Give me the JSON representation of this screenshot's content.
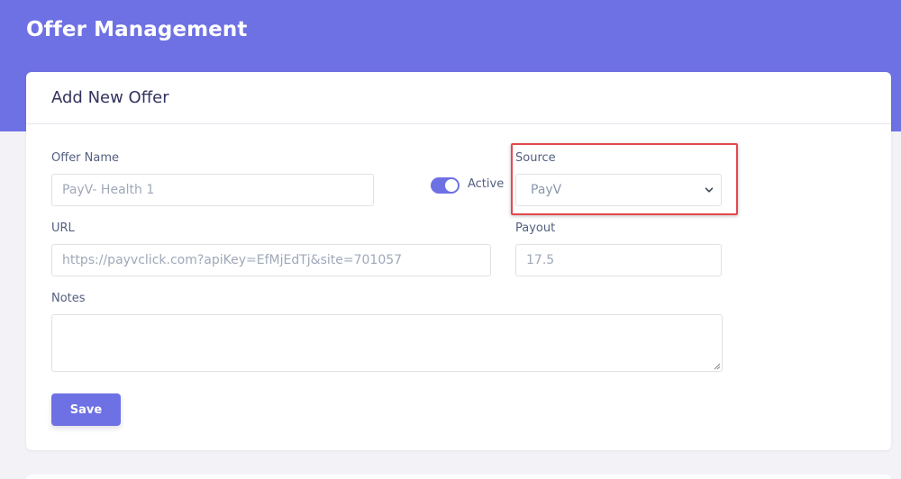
{
  "header": {
    "title": "Offer Management",
    "accent_color": "#6e71e3"
  },
  "card": {
    "title": "Add New Offer"
  },
  "form": {
    "offer_name": {
      "label": "Offer Name",
      "placeholder": "PayV- Health 1"
    },
    "active": {
      "label": "Active",
      "checked": true
    },
    "source": {
      "label": "Source",
      "selected": "PayV",
      "icon": "chevron-down-icon"
    },
    "url": {
      "label": "URL",
      "placeholder": "https://payvclick.com?apiKey=EfMjEdTj&site=701057"
    },
    "payout": {
      "label": "Payout",
      "placeholder": "17.5"
    },
    "notes": {
      "label": "Notes",
      "value": ""
    },
    "save_label": "Save"
  },
  "annotation": {
    "highlight_color": "#e5474c"
  }
}
